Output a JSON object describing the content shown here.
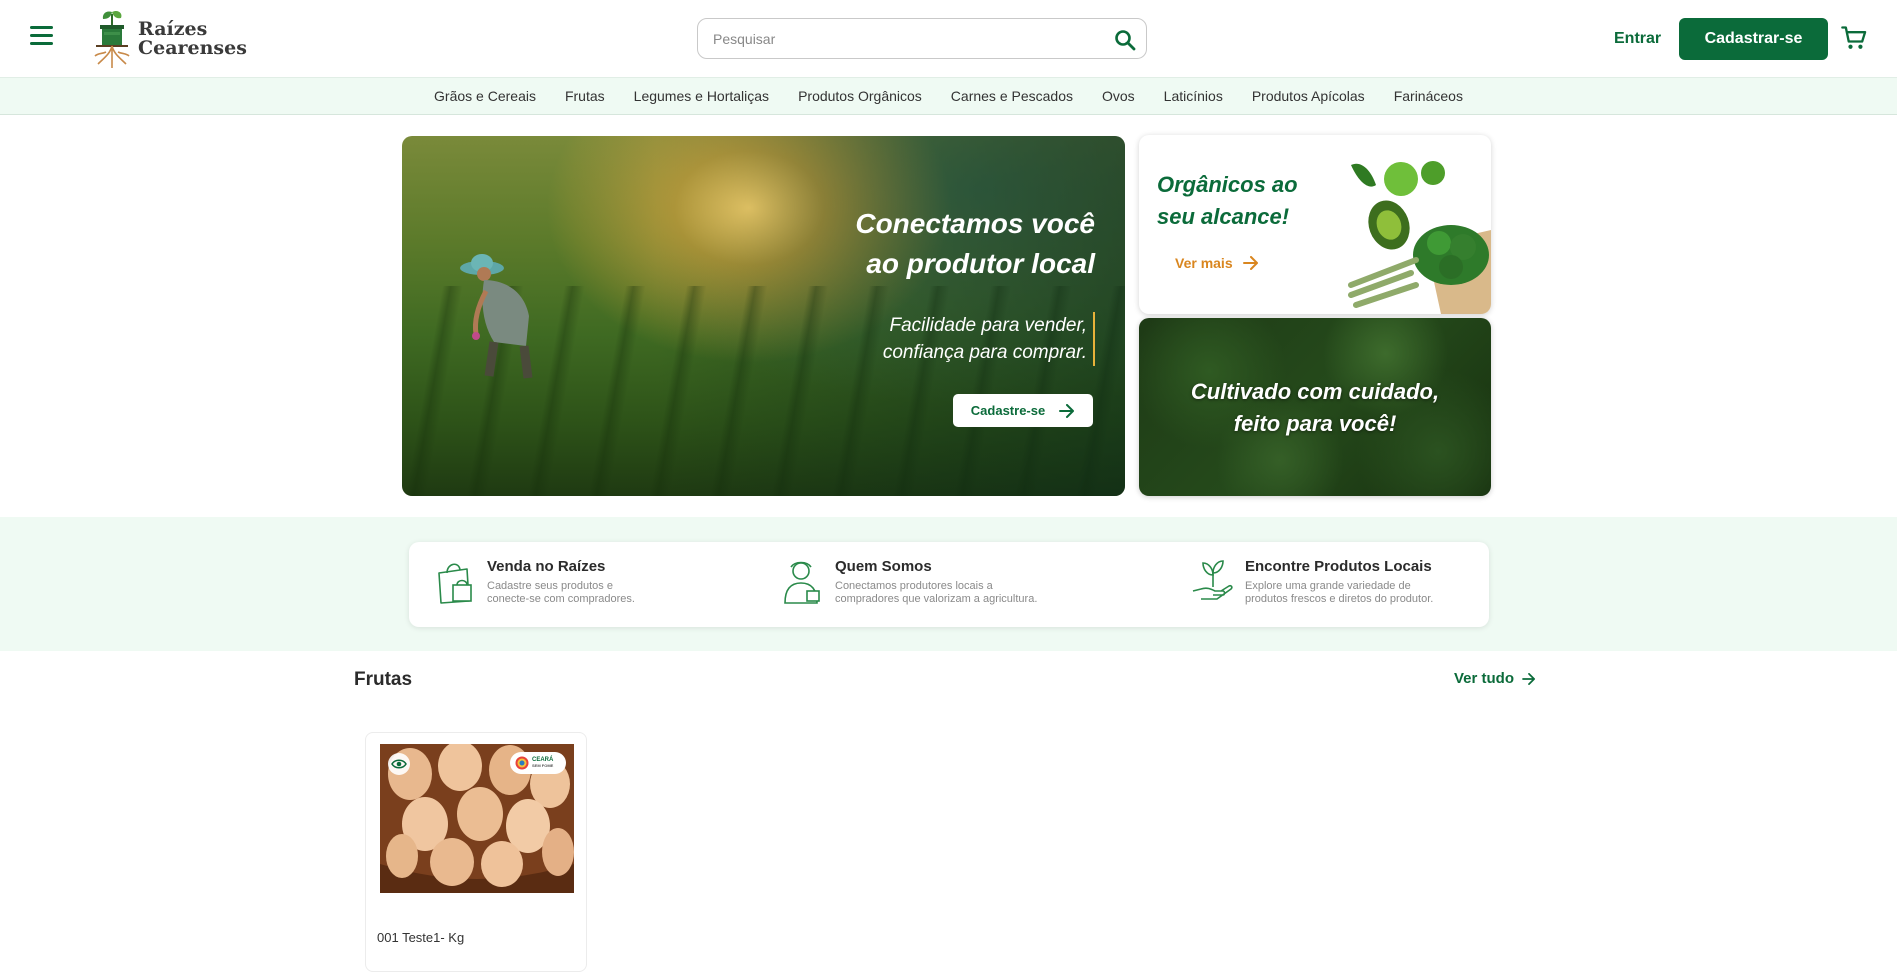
{
  "header": {
    "brand_line1": "Raízes",
    "brand_line2": "Cearenses",
    "search_placeholder": "Pesquisar",
    "login_label": "Entrar",
    "signup_label": "Cadastrar-se",
    "brand_color": "#0b6b3a"
  },
  "categories": [
    "Grãos e Cereais",
    "Frutas",
    "Legumes e Hortaliças",
    "Produtos Orgânicos",
    "Carnes e Pescados",
    "Ovos",
    "Laticínios",
    "Produtos Apícolas",
    "Farináceos"
  ],
  "hero": {
    "title_line1": "Conectamos você",
    "title_line2": "ao produtor local",
    "subtitle_line1": "Facilidade para vender,",
    "subtitle_line2": "confiança para comprar.",
    "cta_label": "Cadastre-se"
  },
  "side_banner_1": {
    "title_line1": "Orgânicos ao",
    "title_line2": "seu alcance!",
    "link_label": "Ver mais"
  },
  "side_banner_2": {
    "title_line1": "Cultivado com cuidado,",
    "title_line2": "feito para você!"
  },
  "features": [
    {
      "title": "Venda no Raízes",
      "desc_line1": "Cadastre seus produtos e",
      "desc_line2": "conecte-se com compradores.",
      "icon": "shopping-bag-icon"
    },
    {
      "title": "Quem Somos",
      "desc_line1": "Conectamos produtores locais a",
      "desc_line2": "compradores que valorizam a agricultura.",
      "icon": "farmer-icon"
    },
    {
      "title": "Encontre Produtos Locais",
      "desc_line1": "Explore uma grande variedade de",
      "desc_line2": "produtos frescos e diretos do produtor.",
      "icon": "hand-plant-icon"
    }
  ],
  "section": {
    "title": "Frutas",
    "see_all_label": "Ver tudo"
  },
  "products": [
    {
      "name": "001 Teste1- Kg",
      "seal_line1": "CEARÁ",
      "seal_line2": "SEM FOME"
    }
  ]
}
